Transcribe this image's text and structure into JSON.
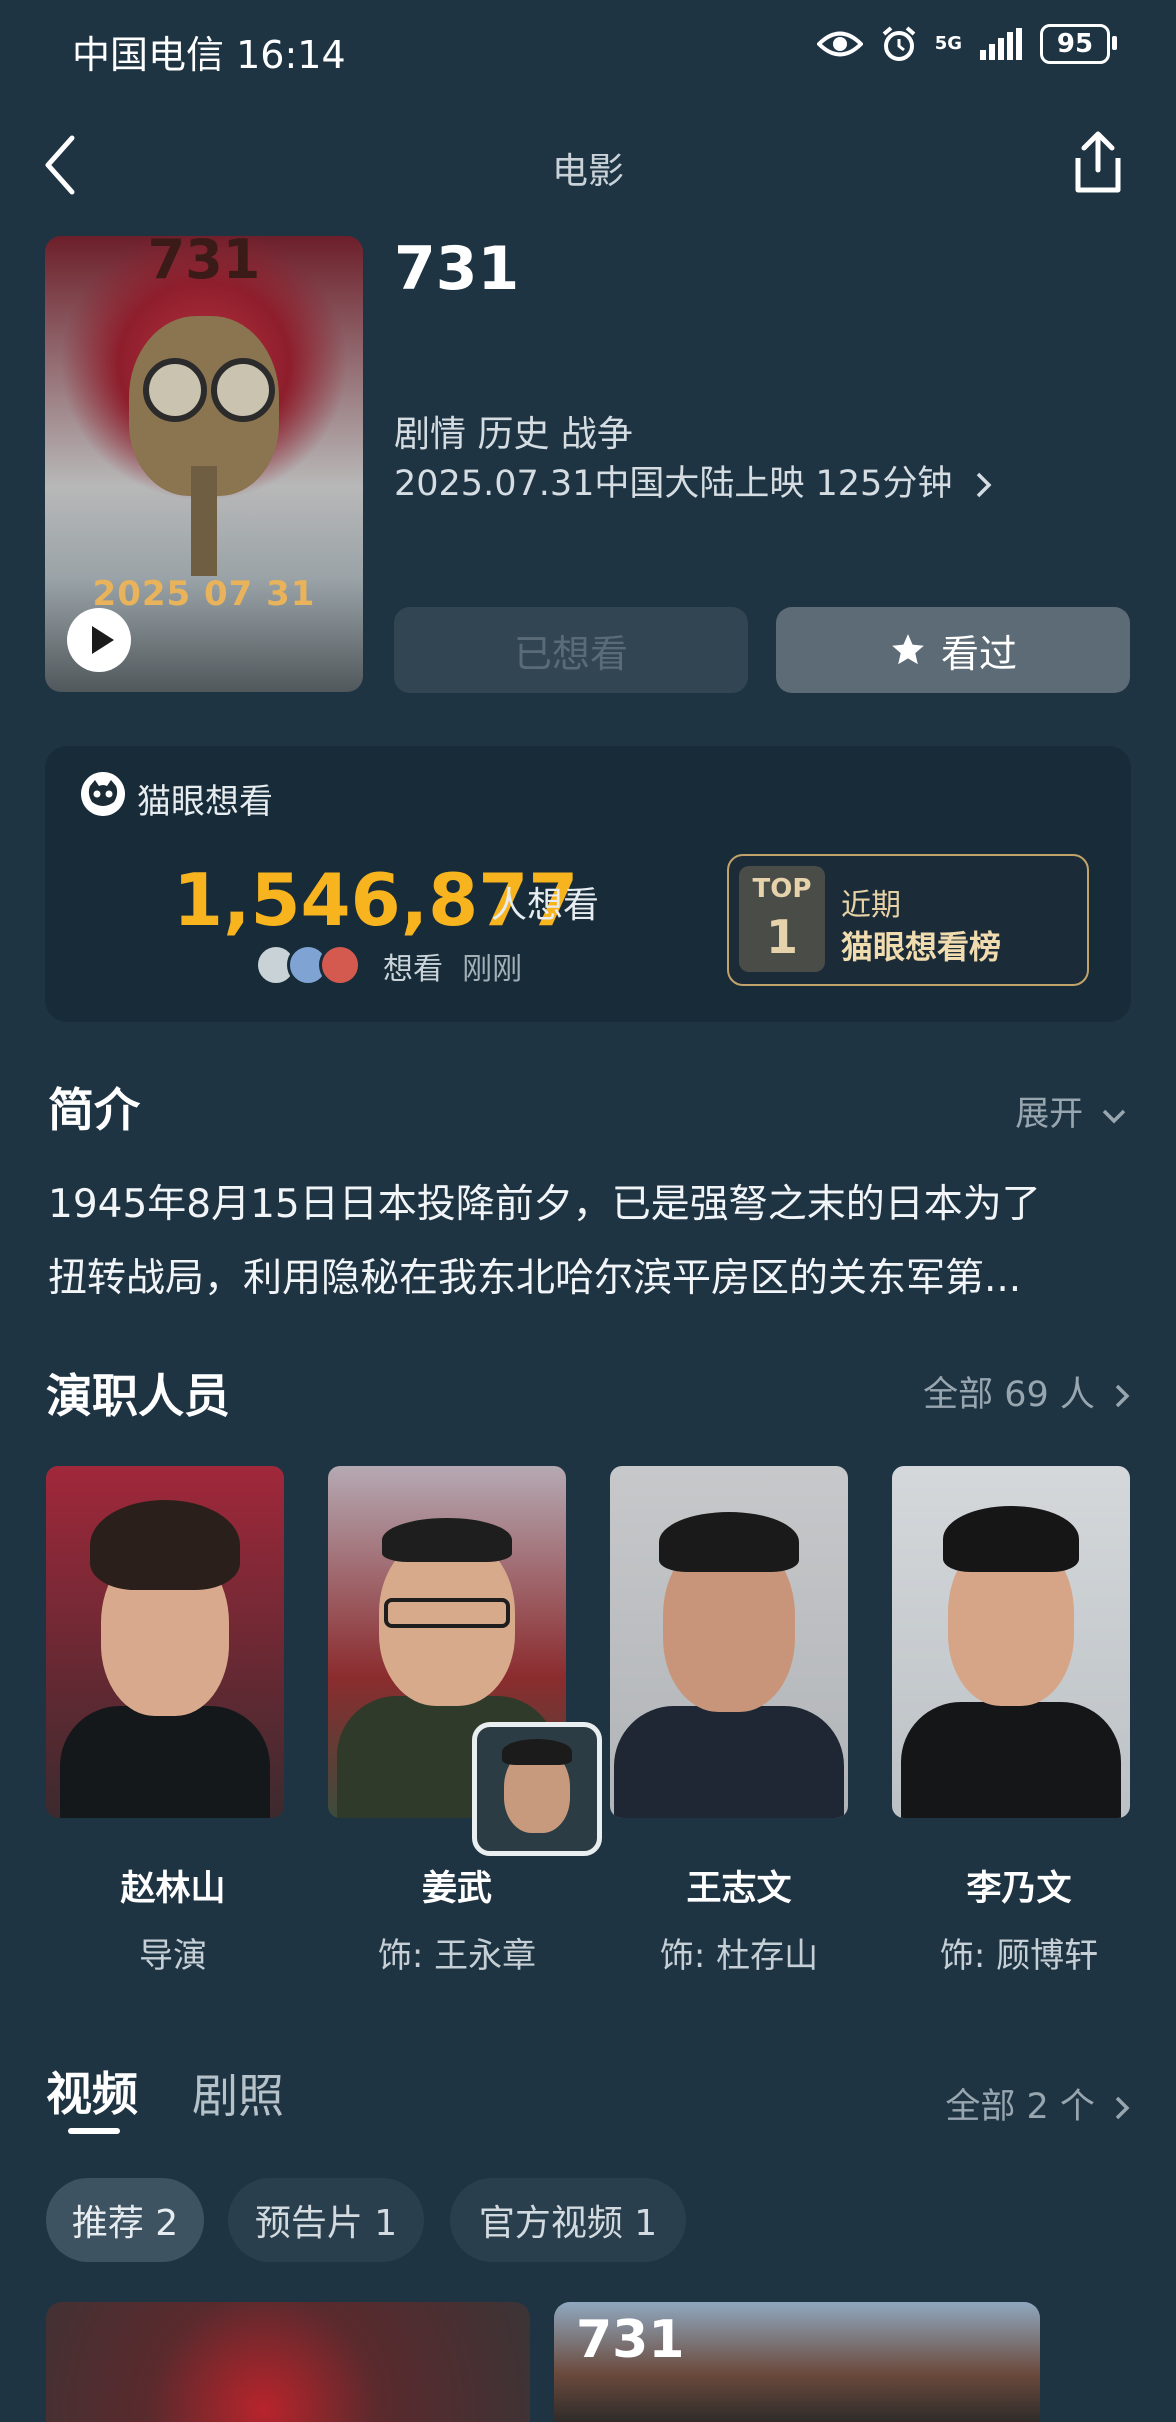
{
  "status": {
    "carrier": "中国电信",
    "time": "16:14",
    "network": "5G",
    "battery": "95"
  },
  "nav": {
    "title": "电影"
  },
  "poster": {
    "title": "731",
    "date": "2025 07 31"
  },
  "movie": {
    "title": "731",
    "genres": "剧情 历史 战争",
    "release": "2025.07.31中国大陆上映 125分钟",
    "btn_wanted": "已想看",
    "btn_seen": "看过"
  },
  "want": {
    "source": "猫眼想看",
    "count": "1,546,877",
    "unit": "人想看",
    "activity_action": "想看",
    "activity_time": "刚刚",
    "rank_badge_top": "TOP",
    "rank_badge_num": "1",
    "rank_line1": "近期",
    "rank_line2": "猫眼想看榜"
  },
  "synopsis": {
    "title": "简介",
    "expand": "展开",
    "line1": "1945年8月15日日本投降前夕，已是强弩之末的日本为了",
    "line2": "扭转战局，利用隐秘在我东北哈尔滨平房区的关东军第..."
  },
  "cast": {
    "title": "演职人员",
    "all": "全部 69 人",
    "members": [
      {
        "name": "赵林山",
        "role": "导演"
      },
      {
        "name": "姜武",
        "role": "饰: 王永章"
      },
      {
        "name": "王志文",
        "role": "饰: 杜存山"
      },
      {
        "name": "李乃文",
        "role": "饰: 顾博轩"
      }
    ]
  },
  "media": {
    "tab_video": "视频",
    "tab_stills": "剧照",
    "all": "全部 2 个",
    "chips": [
      "推荐 2",
      "预告片 1",
      "官方视频 1"
    ],
    "thumb2_title": "731"
  },
  "colors": {
    "bg": "#1f3443",
    "accent": "#f8b41e",
    "card": "#182b38",
    "gold": "#c2a36a"
  }
}
